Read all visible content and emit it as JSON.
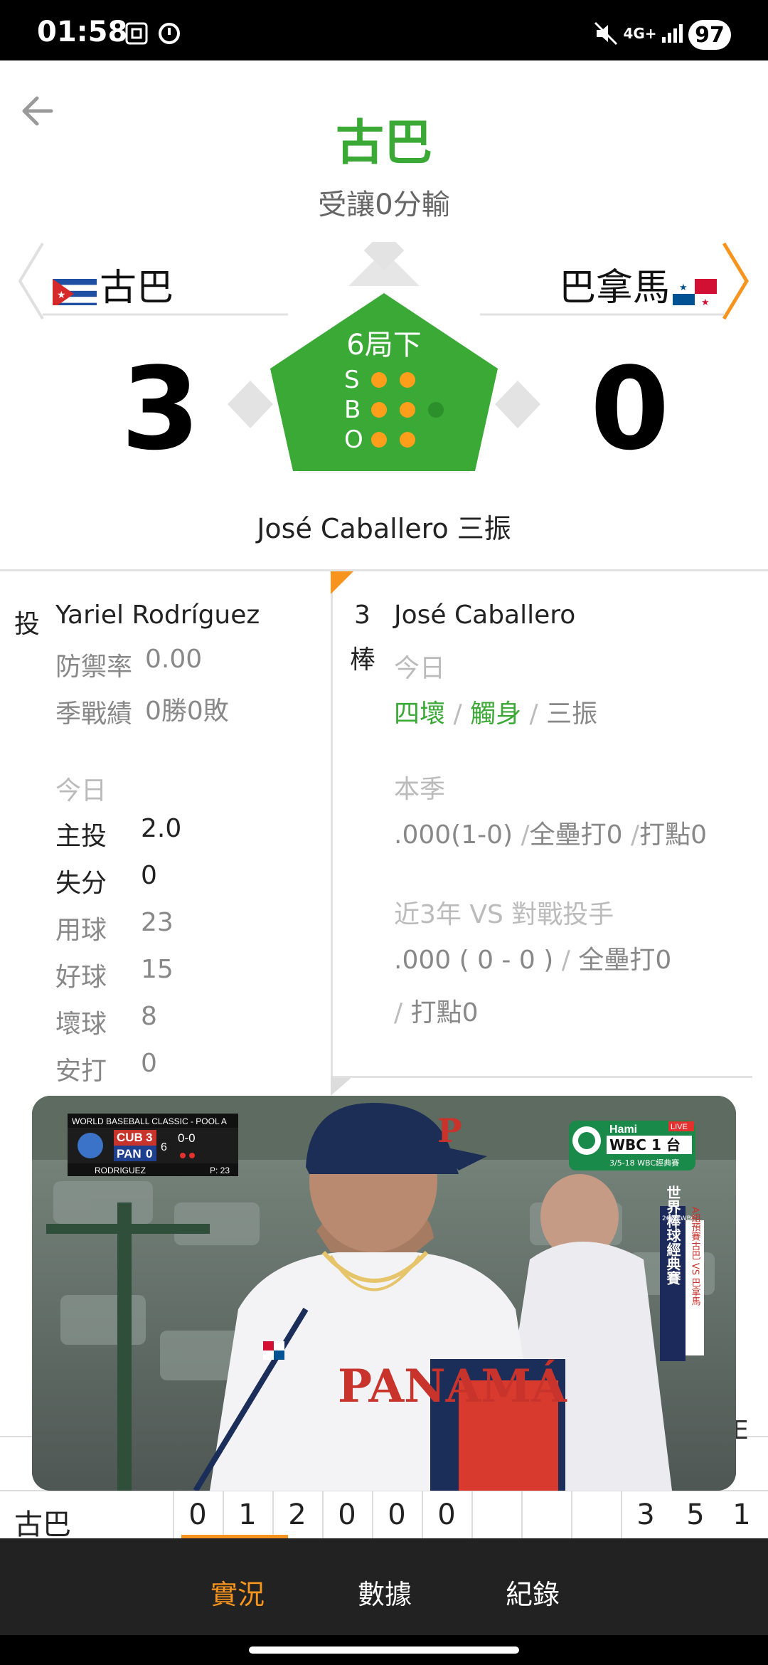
{
  "status_bar": {
    "time": "01:58",
    "network": "4G+",
    "battery": "97"
  },
  "header": {
    "title": "古巴",
    "subtitle": "受讓0分輸"
  },
  "game": {
    "away": {
      "name": "古巴",
      "flag": "cuba-flag",
      "score": "3"
    },
    "home": {
      "name": "巴拿馬",
      "flag": "panama-flag",
      "score": "0"
    },
    "inning": "6局下",
    "count": {
      "s_label": "S",
      "strikes": 2,
      "max_strikes": 2,
      "b_label": "B",
      "balls": 2,
      "max_balls": 3,
      "o_label": "O",
      "outs": 2,
      "max_outs": 2
    },
    "last_play": "José Caballero 三振"
  },
  "pitcher": {
    "role": "投",
    "name": "Yariel Rodríguez",
    "era_label": "防禦率",
    "era": "0.00",
    "record_label": "季戰績",
    "record": "0勝0敗",
    "today_label": "今日",
    "stats": [
      {
        "label": "主投",
        "value": "2.0"
      },
      {
        "label": "失分",
        "value": "0"
      },
      {
        "label": "用球",
        "value": "23"
      },
      {
        "label": "好球",
        "value": "15"
      },
      {
        "label": "壞球",
        "value": "8"
      },
      {
        "label": "安打",
        "value": "0"
      }
    ]
  },
  "batter": {
    "order_num": "3",
    "order_label": "棒",
    "name": "José Caballero",
    "today_label": "今日",
    "today_results": [
      "四壞",
      "觸身",
      "三振"
    ],
    "separator": "/",
    "season_label": "本季",
    "season_avg": ".000(1-0)",
    "season_hr": "全壘打0",
    "season_rbi": "打點0",
    "vs_label": "近3年 VS 對戰投手",
    "vs_avg": ".000 ( 0 - 0 )",
    "vs_hr": "全壘打0",
    "vs_rbi": "打點0"
  },
  "video": {
    "scorebug_title": "WORLD BASEBALL CLASSIC - POOL A",
    "bug_away": "CUB",
    "bug_away_score": "3",
    "bug_home": "PAN",
    "bug_home_score": "0",
    "bug_inning": "6",
    "bug_count": "0-0",
    "bug_pitcher": "RODRIGUEZ",
    "bug_pitches": "P: 23",
    "channel_brand": "Hami",
    "channel_name": "WBC 1 台",
    "channel_live": "LIVE",
    "channel_dates": "3/5-18 WBC經典賽",
    "side_banner": "世界棒球經典賽",
    "side_banner_year": "2026 WBC",
    "side_banner_group": "A組預賽",
    "side_banner_match": "古巴 VS 巴拿馬",
    "jersey_text": "PANAMÁ"
  },
  "boxscore": {
    "header_E": "E",
    "team": "古巴",
    "innings": [
      "0",
      "1",
      "2",
      "0",
      "0",
      "0",
      "",
      "",
      ""
    ],
    "runs": "3",
    "hits": "5",
    "errors": "1"
  },
  "bottom_nav": {
    "items": [
      "實況",
      "數據",
      "紀錄"
    ],
    "active_index": 0
  },
  "colors": {
    "accent_green": "#3aa935",
    "accent_orange": "#f7941d",
    "nav_bg": "#222222"
  }
}
